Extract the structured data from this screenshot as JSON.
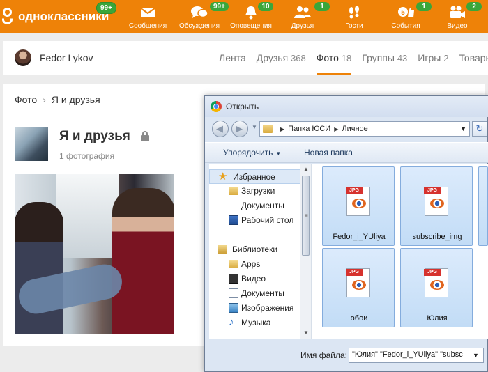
{
  "topbar": {
    "logo_text": "одноклассники",
    "logo_badge": "99+",
    "nav": [
      {
        "label": "Сообщения",
        "icon": "envelope-icon",
        "badge": ""
      },
      {
        "label": "Обсуждения",
        "icon": "chat-bubbles-icon",
        "badge": "99+"
      },
      {
        "label": "Оповещения",
        "icon": "bell-icon",
        "badge": "10"
      },
      {
        "label": "Друзья",
        "icon": "friends-icon",
        "badge": "1"
      },
      {
        "label": "Гости",
        "icon": "footprints-icon",
        "badge": ""
      },
      {
        "label": "События",
        "icon": "like-icon",
        "badge": "1"
      },
      {
        "label": "Видео",
        "icon": "video-camera-icon",
        "badge": "2"
      }
    ],
    "events_counter": "5"
  },
  "profile": {
    "name": "Fedor Lykov",
    "tabs": [
      {
        "label": "Лента",
        "count": ""
      },
      {
        "label": "Друзья",
        "count": "368"
      },
      {
        "label": "Фото",
        "count": "18"
      },
      {
        "label": "Группы",
        "count": "43"
      },
      {
        "label": "Игры",
        "count": "2"
      },
      {
        "label": "Товары",
        "count": ""
      }
    ],
    "active_tab": "Фото"
  },
  "album": {
    "breadcrumb_root": "Фото",
    "breadcrumb_sep": "›",
    "breadcrumb_current": "Я и друзья",
    "title": "Я и друзья",
    "count": "1 фотография"
  },
  "dialog": {
    "title": "Открыть",
    "path": [
      "Папка ЮСИ",
      "Личное"
    ],
    "toolbar": {
      "organize": "Упорядочить",
      "new_folder": "Новая папка"
    },
    "tree": [
      {
        "label": "Избранное",
        "icon": "star-icon"
      },
      {
        "label": "Загрузки",
        "icon": "folder-icon"
      },
      {
        "label": "Документы",
        "icon": "document-icon"
      },
      {
        "label": "Рабочий стол",
        "icon": "desktop-icon"
      },
      {
        "label": "Библиотеки",
        "icon": "library-icon"
      },
      {
        "label": "Apps",
        "icon": "folder-icon"
      },
      {
        "label": "Видео",
        "icon": "video-icon"
      },
      {
        "label": "Документы",
        "icon": "document-icon"
      },
      {
        "label": "Изображения",
        "icon": "images-icon"
      },
      {
        "label": "Музыка",
        "icon": "music-icon"
      }
    ],
    "files": [
      {
        "name": "Fedor_i_YUliya",
        "type": "JPG"
      },
      {
        "name": "subscribe_img",
        "type": "JPG"
      },
      {
        "name": "обои",
        "type": "JPG"
      },
      {
        "name": "Юлия",
        "type": "JPG"
      }
    ],
    "filename_label": "Имя файла:",
    "filename_value": "\"Юлия\" \"Fedor_i_YUliya\" \"subsc"
  },
  "colors": {
    "brand": "#ee8208",
    "badge": "#3aa63a"
  }
}
